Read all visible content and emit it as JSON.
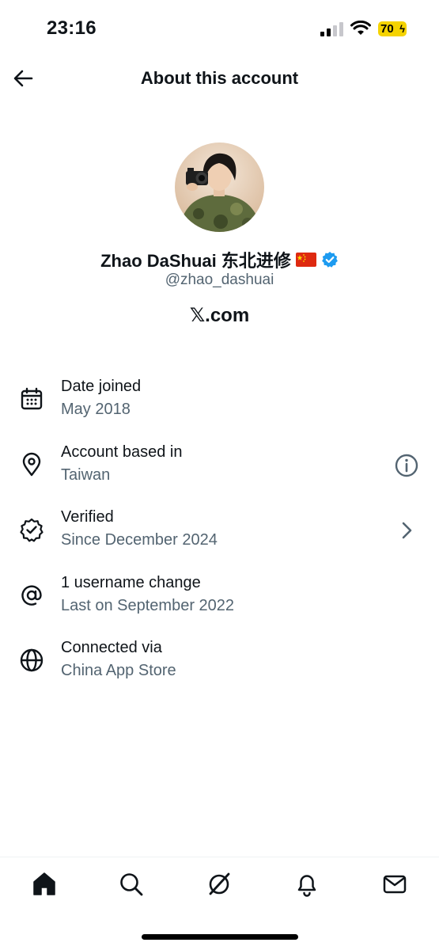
{
  "status_bar": {
    "time": "23:16",
    "battery": "70"
  },
  "header": {
    "title": "About this account"
  },
  "profile": {
    "display_name": "Zhao DaShuai 东北进修",
    "handle": "@zhao_dashuai",
    "source": "𝕏.com"
  },
  "info": [
    {
      "label": "Date joined",
      "value": "May 2018",
      "icon": "calendar-icon"
    },
    {
      "label": "Account based in",
      "value": "Taiwan",
      "icon": "location-pin-icon",
      "action": "info-icon"
    },
    {
      "label": "Verified",
      "value": "Since December 2024",
      "icon": "verified-badge-outline-icon",
      "action": "chevron-right-icon"
    },
    {
      "label": "1 username change",
      "value": "Last on September 2022",
      "icon": "at-sign-icon"
    },
    {
      "label": "Connected via",
      "value": "China App Store",
      "icon": "globe-icon"
    }
  ],
  "nav": [
    "home-icon",
    "search-icon",
    "grok-icon",
    "notifications-icon",
    "messages-icon"
  ],
  "colors": {
    "text": "#0f1419",
    "secondary": "#536471",
    "verified": "#1d9bf0",
    "battery": "#f5d300"
  }
}
